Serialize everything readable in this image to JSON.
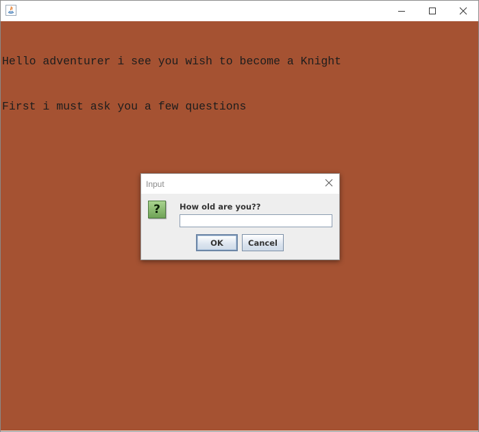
{
  "window": {
    "title": "",
    "controls": {
      "minimize_icon": "minimize-icon",
      "maximize_icon": "maximize-icon",
      "close_icon": "close-icon"
    }
  },
  "console": {
    "background_color": "#a55232",
    "lines": [
      "Hello adventurer i see you wish to become a Knight",
      "First i must ask you a few questions"
    ]
  },
  "dialog": {
    "title": "Input",
    "icon": "question-icon",
    "prompt": "How old are you??",
    "input_value": "",
    "ok_label": "OK",
    "cancel_label": "Cancel"
  }
}
